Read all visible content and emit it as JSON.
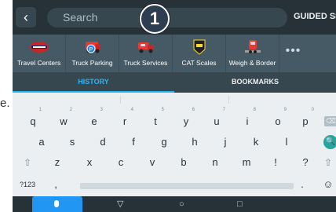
{
  "side_text": "e.",
  "search": {
    "back_label": "‹",
    "placeholder": "Search",
    "guided_label": "GUIDED SEARC"
  },
  "callout": {
    "number": "1"
  },
  "categories": [
    {
      "label": "Travel Centers",
      "icon": "travel-centers-logo"
    },
    {
      "label": "Truck Parking",
      "icon": "truck-parking-icon"
    },
    {
      "label": "Truck Services",
      "icon": "truck-services-icon"
    },
    {
      "label": "CAT Scales",
      "icon": "cat-scales-icon"
    },
    {
      "label": "Weigh & Border",
      "icon": "weigh-border-icon"
    },
    {
      "label": "•••",
      "icon": "more-icon"
    }
  ],
  "tabs": {
    "history": "HISTORY",
    "bookmarks": "BOOKMARKS"
  },
  "keyboard": {
    "row1": [
      "q",
      "w",
      "e",
      "r",
      "t",
      "y",
      "u",
      "i",
      "o",
      "p"
    ],
    "row1_hints": [
      "1",
      "2",
      "3",
      "4",
      "5",
      "6",
      "7",
      "8",
      "9",
      "0"
    ],
    "row2": [
      "a",
      "s",
      "d",
      "f",
      "g",
      "h",
      "j",
      "k",
      "l"
    ],
    "row3": [
      "z",
      "x",
      "c",
      "v",
      "b",
      "n",
      "m",
      "!",
      "?"
    ],
    "symbols_label": "?123",
    "comma": ",",
    "period": ".",
    "backspace": "⌫",
    "shift": "⇧",
    "go": "🔍",
    "emoji": "☺"
  },
  "navbar": {
    "back": "▽",
    "home": "○",
    "recents": "□"
  },
  "colors": {
    "accent": "#29b6f6",
    "go": "#26a69a",
    "mic": "#2196f3"
  }
}
